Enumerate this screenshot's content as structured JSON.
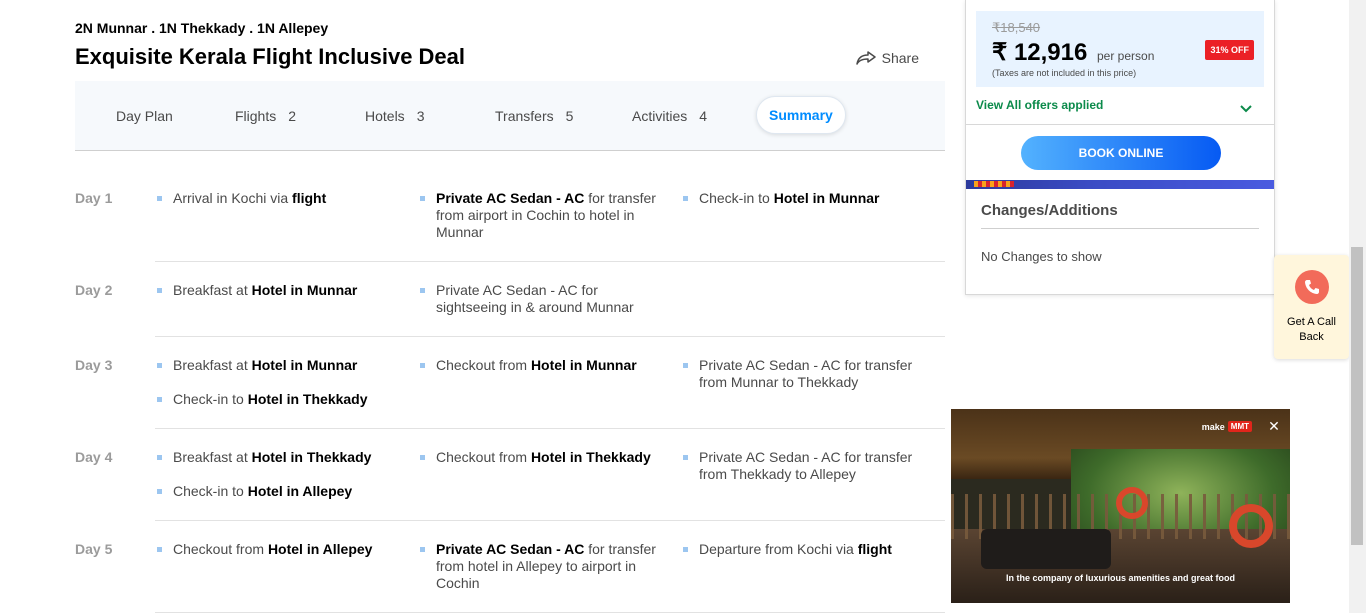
{
  "package": {
    "cities": "2N Munnar . 1N Thekkady . 1N Allepey",
    "title": "Exquisite Kerala Flight Inclusive Deal",
    "share_label": "Share"
  },
  "tabs": [
    {
      "label": "Day Plan",
      "count": ""
    },
    {
      "label": "Flights",
      "count": "2"
    },
    {
      "label": "Hotels",
      "count": "3"
    },
    {
      "label": "Transfers",
      "count": "5"
    },
    {
      "label": "Activities",
      "count": "4"
    },
    {
      "label": "Summary",
      "count": ""
    }
  ],
  "days": [
    {
      "label": "Day 1",
      "items": [
        {
          "pre": "Arrival in Kochi via ",
          "bold": "flight",
          "post": ""
        },
        {
          "pre": "",
          "bold": "Private AC Sedan - AC",
          "post": " for transfer from airport in Cochin to hotel in Munnar"
        },
        {
          "pre": "Check-in to ",
          "bold": "Hotel in Munnar",
          "post": ""
        }
      ]
    },
    {
      "label": "Day 2",
      "items": [
        {
          "pre": "Breakfast at ",
          "bold": "Hotel in Munnar",
          "post": ""
        },
        {
          "pre": "Private AC Sedan - AC for sightseeing in & around Munnar",
          "bold": "",
          "post": ""
        }
      ]
    },
    {
      "label": "Day 3",
      "items": [
        {
          "pre": "Breakfast at ",
          "bold": "Hotel in Munnar",
          "post": ""
        },
        {
          "pre": "Checkout from ",
          "bold": "Hotel in Munnar",
          "post": ""
        },
        {
          "pre": "Private AC Sedan - AC for transfer from Munnar to Thekkady",
          "bold": "",
          "post": ""
        },
        {
          "pre": "Check-in to ",
          "bold": "Hotel in Thekkady",
          "post": ""
        }
      ]
    },
    {
      "label": "Day 4",
      "items": [
        {
          "pre": "Breakfast at ",
          "bold": "Hotel in Thekkady",
          "post": ""
        },
        {
          "pre": "Checkout from ",
          "bold": "Hotel in Thekkady",
          "post": ""
        },
        {
          "pre": "Private AC Sedan - AC for transfer from Thekkady to Allepey",
          "bold": "",
          "post": ""
        },
        {
          "pre": "Check-in to ",
          "bold": "Hotel in Allepey",
          "post": ""
        }
      ]
    },
    {
      "label": "Day 5",
      "items": [
        {
          "pre": "Checkout from ",
          "bold": "Hotel in Allepey",
          "post": ""
        },
        {
          "pre": "",
          "bold": "Private AC Sedan - AC",
          "post": " for transfer from hotel in Allepey to airport in Cochin"
        },
        {
          "pre": "Departure from Kochi via ",
          "bold": "flight",
          "post": ""
        }
      ]
    }
  ],
  "pricing": {
    "old_price": "₹18,540",
    "new_price": "₹ 12,916",
    "per_person": "per person",
    "tax_note": "(Taxes are not included in this price)",
    "discount_badge": "31% OFF",
    "offers_link": "View All offers applied",
    "book_button": "BOOK ONLINE",
    "accent_color": "#008cff",
    "offer_color": "#0b8a4a"
  },
  "changes": {
    "title": "Changes/Additions",
    "empty_text": "No Changes to show"
  },
  "callback": {
    "label": "Get A Call Back"
  },
  "video": {
    "brand": "make",
    "caption": "In the company of luxurious amenities and great food"
  },
  "icons": {
    "share": "share-icon",
    "chevron": "chevron-down-icon",
    "phone": "phone-icon",
    "close": "close-icon"
  }
}
